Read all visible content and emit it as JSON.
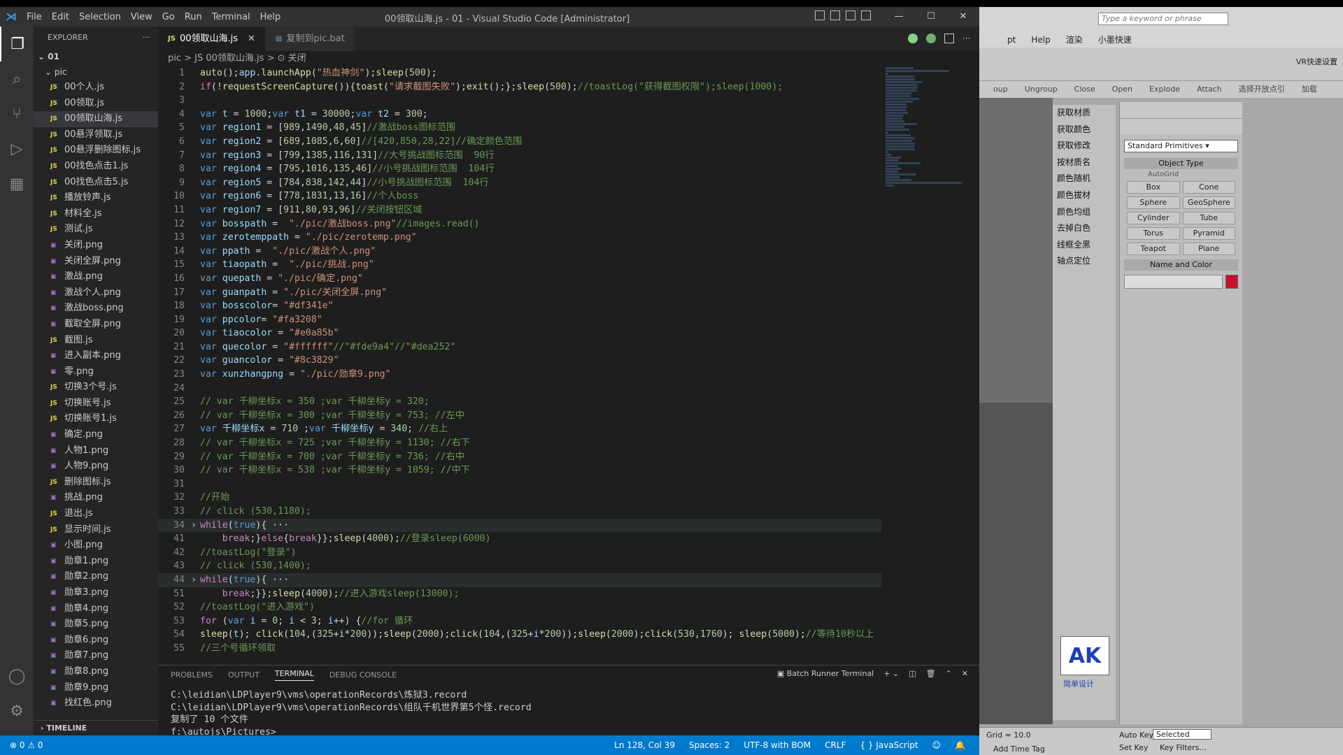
{
  "window": {
    "title": "00领取山海.js - 01 - Visual Studio Code [Administrator]",
    "logo": "vscode-logo-icon"
  },
  "menu": [
    "File",
    "Edit",
    "Selection",
    "View",
    "Go",
    "Run",
    "Terminal",
    "Help"
  ],
  "explorer": {
    "header": "EXPLORER",
    "root": "01",
    "folder": "pic",
    "more": "···",
    "files": [
      {
        "name": "00个人.js",
        "type": "js"
      },
      {
        "name": "00领取.js",
        "type": "js"
      },
      {
        "name": "00领取山海.js",
        "type": "js",
        "active": true
      },
      {
        "name": "00悬浮领取.js",
        "type": "js"
      },
      {
        "name": "00悬浮删除图标.js",
        "type": "js"
      },
      {
        "name": "00找色点击1.js",
        "type": "js"
      },
      {
        "name": "00找色点击5.js",
        "type": "js"
      },
      {
        "name": "播放铃声.js",
        "type": "js"
      },
      {
        "name": "材料全.js",
        "type": "js"
      },
      {
        "name": "测试.js",
        "type": "js"
      },
      {
        "name": "关闭.png",
        "type": "img"
      },
      {
        "name": "关闭全屏.png",
        "type": "img"
      },
      {
        "name": "激战.png",
        "type": "img"
      },
      {
        "name": "激战个人.png",
        "type": "img"
      },
      {
        "name": "激战boss.png",
        "type": "img"
      },
      {
        "name": "截取全屏.png",
        "type": "img"
      },
      {
        "name": "截图.js",
        "type": "js"
      },
      {
        "name": "进入副本.png",
        "type": "img"
      },
      {
        "name": "零.png",
        "type": "img"
      },
      {
        "name": "切换3个号.js",
        "type": "js"
      },
      {
        "name": "切换账号.js",
        "type": "js"
      },
      {
        "name": "切换账号1.js",
        "type": "js"
      },
      {
        "name": "确定.png",
        "type": "img"
      },
      {
        "name": "人物1.png",
        "type": "img"
      },
      {
        "name": "人物9.png",
        "type": "img"
      },
      {
        "name": "删除图标.js",
        "type": "js"
      },
      {
        "name": "挑战.png",
        "type": "img"
      },
      {
        "name": "退出.js",
        "type": "js"
      },
      {
        "name": "显示时间.js",
        "type": "js"
      },
      {
        "name": "小图.png",
        "type": "img"
      },
      {
        "name": "勋章1.png",
        "type": "img"
      },
      {
        "name": "勋章2.png",
        "type": "img"
      },
      {
        "name": "勋章3.png",
        "type": "img"
      },
      {
        "name": "勋章4.png",
        "type": "img"
      },
      {
        "name": "勋章5.png",
        "type": "img"
      },
      {
        "name": "勋章6.png",
        "type": "img"
      },
      {
        "name": "勋章7.png",
        "type": "img"
      },
      {
        "name": "勋章8.png",
        "type": "img"
      },
      {
        "name": "勋章9.png",
        "type": "img"
      },
      {
        "name": "找红色.png",
        "type": "img"
      }
    ],
    "timeline": "TIMELINE"
  },
  "tabs": [
    {
      "label": "00领取山海.js",
      "active": true,
      "icon": "JS"
    },
    {
      "label": "复制到pic.bat",
      "active": false,
      "icon": "▤"
    }
  ],
  "breadcrumb": "pic > JS 00领取山海.js > ⊙ 关闭",
  "code": [
    {
      "n": "1",
      "t": "auto();app.launchApp(\"热血神剑\");sleep(500);"
    },
    {
      "n": "2",
      "t": "if(!requestScreenCapture()){toast(\"请求截图失败\");exit();};sleep(500);//toastLog(\"获得截图权限\");sleep(1000);"
    },
    {
      "n": "3",
      "t": ""
    },
    {
      "n": "4",
      "t": "var t = 1000;var t1 = 30000;var t2 = 300;"
    },
    {
      "n": "5",
      "t": "var region1 = [989,1490,48,45]//激战boss图标范围"
    },
    {
      "n": "6",
      "t": "var region2 = [689,1085,6,60]//[420,850,28,22]//确定颜色范围"
    },
    {
      "n": "7",
      "t": "var region3 = [799,1385,116,131]//大号挑战图标范围  90行"
    },
    {
      "n": "8",
      "t": "var region4 = [795,1016,135,46]//小号挑战图标范围  104行"
    },
    {
      "n": "9",
      "t": "var region5 = [784,838,142,44]//小号挑战图标范围  104行"
    },
    {
      "n": "10",
      "t": "var region6 = [778,1831,13,16]//个人boss"
    },
    {
      "n": "11",
      "t": "var region7 = [911,80,93,96]//关闭按钮区域"
    },
    {
      "n": "12",
      "t": "var bosspath =  \"./pic/激战boss.png\"//images.read()"
    },
    {
      "n": "13",
      "t": "var zerotemppath = \"./pic/zerotemp.png\""
    },
    {
      "n": "14",
      "t": "var ppath =  \"./pic/激战个人.png\""
    },
    {
      "n": "15",
      "t": "var tiaopath =  \"./pic/挑战.png\""
    },
    {
      "n": "16",
      "t": "var quepath = \"./pic/确定.png\""
    },
    {
      "n": "17",
      "t": "var guanpath = \"./pic/关闭全屏.png\""
    },
    {
      "n": "18",
      "t": "var bosscolor= \"#df341e\""
    },
    {
      "n": "19",
      "t": "var ppcolor= \"#fa3208\""
    },
    {
      "n": "20",
      "t": "var tiaocolor = \"#e0a85b\""
    },
    {
      "n": "21",
      "t": "var quecolor = \"#ffffff\"//\"#fde9a4\"//\"#dea252\""
    },
    {
      "n": "22",
      "t": "var guancolor = \"#8c3829\""
    },
    {
      "n": "23",
      "t": "var xunzhangpng = \"./pic/勋章9.png\""
    },
    {
      "n": "24",
      "t": ""
    },
    {
      "n": "25",
      "t": "// var 千柳坐标x = 350 ;var 千柳坐标y = 320;"
    },
    {
      "n": "26",
      "t": "// var 千柳坐标x = 300 ;var 千柳坐标y = 753; //左中"
    },
    {
      "n": "27",
      "t": "var 千柳坐标x = 710 ;var 千柳坐标y = 340; //右上"
    },
    {
      "n": "28",
      "t": "// var 千柳坐标x = 725 ;var 千柳坐标y = 1130; //右下"
    },
    {
      "n": "29",
      "t": "// var 千柳坐标x = 700 ;var 千柳坐标y = 736; //右中"
    },
    {
      "n": "30",
      "t": "// var 千柳坐标x = 538 ;var 千柳坐标y = 1059; //中下"
    },
    {
      "n": "31",
      "t": ""
    },
    {
      "n": "32",
      "t": "//开始"
    },
    {
      "n": "33",
      "t": "// click (530,1180);"
    },
    {
      "n": "34",
      "t": "while(true){ ···",
      "fold": true,
      "hl": true
    },
    {
      "n": "41",
      "t": "    break;}else{break}};sleep(4000);//登录sleep(6000)"
    },
    {
      "n": "42",
      "t": "//toastLog(\"登录\")"
    },
    {
      "n": "43",
      "t": "// click (530,1400);"
    },
    {
      "n": "44",
      "t": "while(true){ ···",
      "fold": true,
      "hl": true
    },
    {
      "n": "51",
      "t": "    break;}};sleep(4000);//进入游戏sleep(13000);"
    },
    {
      "n": "52",
      "t": "//toastLog(\"进入游戏\")"
    },
    {
      "n": "53",
      "t": "for (var i = 0; i < 3; i++) {//for 循环"
    },
    {
      "n": "54",
      "t": "sleep(t); click(104,(325+i*200));sleep(2000);click(104,(325+i*200));sleep(2000);click(530,1760); sleep(5000);//等待10秒以上"
    },
    {
      "n": "55",
      "t": "//三个号循环领取"
    }
  ],
  "panel": {
    "tabs": [
      "PROBLEMS",
      "OUTPUT",
      "TERMINAL",
      "DEBUG CONSOLE"
    ],
    "active": "TERMINAL",
    "terminal_name": "Batch Runner Terminal",
    "lines": [
      "C:\\leidian\\LDPlayer9\\vms\\operationRecords\\炼狱3.record",
      "C:\\leidian\\LDPlayer9\\vms\\operationRecords\\组队千机世界第5个怪.record",
      "复制了 10 个文件",
      "f:\\autojs\\Pictures>"
    ]
  },
  "status": {
    "errors": "⊗ 0 ⚠ 0",
    "ln_col": "Ln 128, Col 39",
    "spaces": "Spaces: 2",
    "encoding": "UTF-8 with BOM",
    "eol": "CRLF",
    "lang": "{ } JavaScript"
  },
  "max": {
    "search_placeholder": "Type a keyword or phrase",
    "menu": [
      "pt",
      "Help",
      "渲染",
      "小墨快速"
    ],
    "labels": [
      "oup",
      "Ungroup",
      "Close",
      "Open",
      "Explode",
      "Attach",
      "选择开放点引",
      "加载"
    ],
    "cn_tools": [
      "获取材质",
      "获取颜色",
      "获取修改",
      "按材质名",
      "颜色随机",
      "颜色拔材",
      "颜色均组",
      "去掉白色",
      "线框全黑",
      "轴点定位"
    ],
    "dropdown": "Standard Primitives",
    "object_type": "Object Type",
    "autogrid": "AutoGrid",
    "primitives": [
      "Box",
      "Cone",
      "Sphere",
      "GeoSphere",
      "Cylinder",
      "Tube",
      "Torus",
      "Pyramid",
      "Teapot",
      "Plane"
    ],
    "name_color": "Name and Color",
    "ak": "AK",
    "ak_sub": "简单设计",
    "grid": "Grid = 10.0",
    "autokey": "Auto Key",
    "selected": "Selected",
    "setkey": "Set Key",
    "keyfilters": "Key Filters...",
    "addtimetag": "Add Time Tag",
    "quick": "VR快速设置"
  }
}
